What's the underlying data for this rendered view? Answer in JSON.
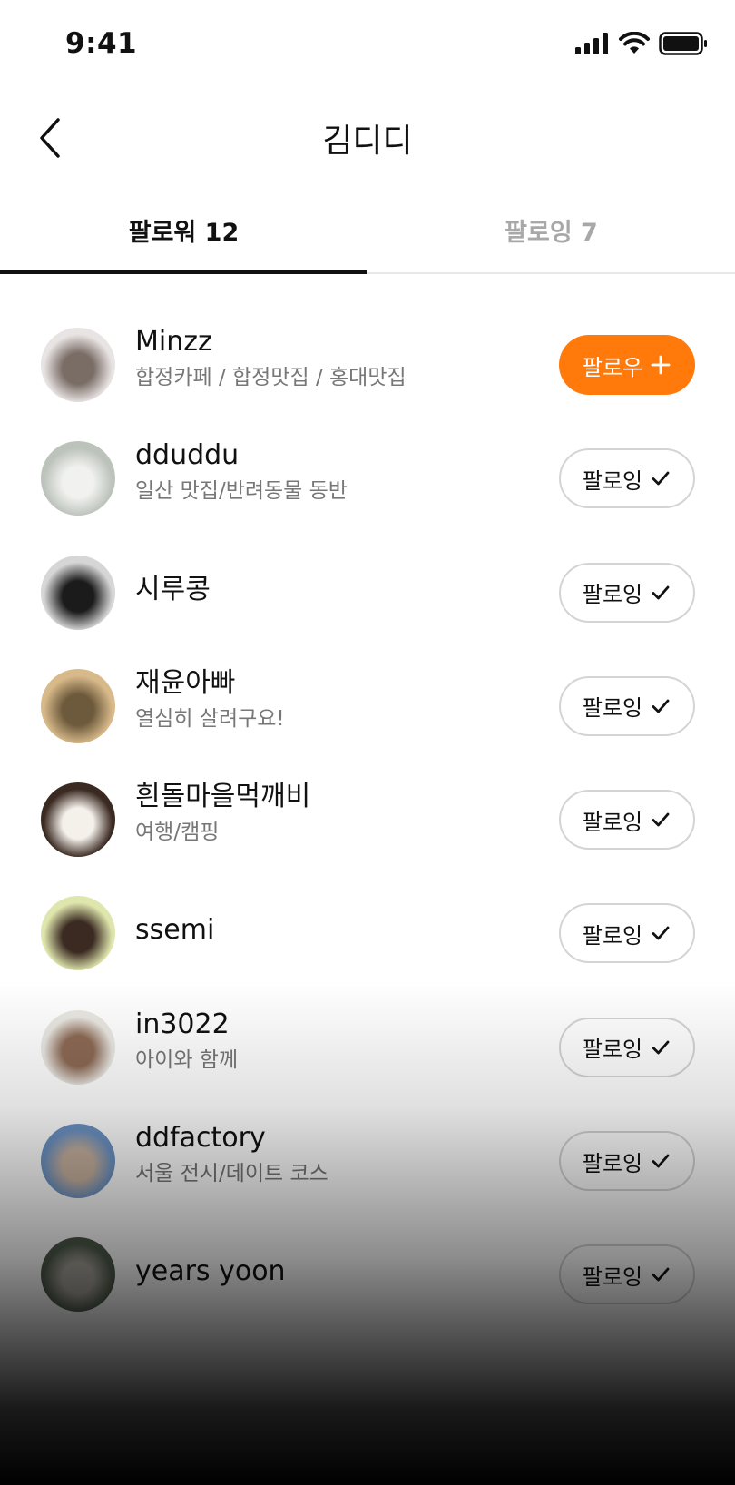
{
  "status_bar": {
    "time": "9:41"
  },
  "header": {
    "title": "김디디",
    "back_icon": "chevron-left-icon"
  },
  "tabs": [
    {
      "label": "팔로워 12",
      "active": true
    },
    {
      "label": "팔로잉 7",
      "active": false
    }
  ],
  "users": [
    {
      "name": "Minzz",
      "bio": "합정카페 / 합정맛집 / 홍대맛집",
      "button": "팔로우",
      "button_icon": "plus-icon",
      "following": false,
      "avatar_colors": [
        "#e9e4e4",
        "#7a6d66"
      ]
    },
    {
      "name": "dduddu",
      "bio": "일산 맛집/반려동물 동반",
      "button": "팔로잉",
      "button_icon": "check-icon",
      "following": true,
      "avatar_colors": [
        "#bcc3bb",
        "#f1f1ef"
      ]
    },
    {
      "name": "시루콩",
      "bio": "",
      "button": "팔로잉",
      "button_icon": "check-icon",
      "following": true,
      "avatar_colors": [
        "#d6d6d6",
        "#1b1b1b"
      ]
    },
    {
      "name": "재윤아빠",
      "bio": "열심히 살려구요!",
      "button": "팔로잉",
      "button_icon": "check-icon",
      "following": true,
      "avatar_colors": [
        "#d8b98a",
        "#6d5a3c"
      ]
    },
    {
      "name": "흰돌마을먹깨비",
      "bio": "여행/캠핑",
      "button": "팔로잉",
      "button_icon": "check-icon",
      "following": true,
      "avatar_colors": [
        "#3a2a22",
        "#f4f0ea"
      ]
    },
    {
      "name": "ssemi",
      "bio": "",
      "button": "팔로잉",
      "button_icon": "check-icon",
      "following": true,
      "avatar_colors": [
        "#dfe6ad",
        "#3b2a22"
      ]
    },
    {
      "name": "in3022",
      "bio": "아이와 함께",
      "button": "팔로잉",
      "button_icon": "check-icon",
      "following": true,
      "avatar_colors": [
        "#e9e7e2",
        "#8d6a55"
      ]
    },
    {
      "name": "ddfactory",
      "bio": "서울 전시/데이트 코스",
      "button": "팔로잉",
      "button_icon": "check-icon",
      "following": true,
      "avatar_colors": [
        "#6d93c4",
        "#c9b3a0"
      ]
    },
    {
      "name": "years yoon",
      "bio": "",
      "button": "팔로잉",
      "button_icon": "check-icon",
      "following": true,
      "avatar_colors": [
        "#4d5a4a",
        "#a7a39a"
      ]
    }
  ],
  "colors": {
    "accent": "#ff7a0a",
    "text": "#111111",
    "muted": "#777777",
    "inactive_tab": "#a8a8a8"
  }
}
